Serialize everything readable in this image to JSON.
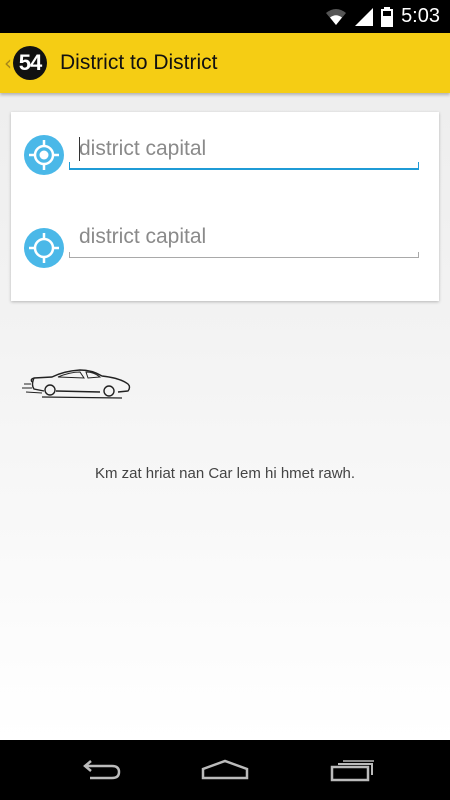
{
  "status_bar": {
    "time": "5:03",
    "icons": [
      "wifi-icon",
      "signal-icon",
      "battery-icon"
    ]
  },
  "action_bar": {
    "logo_text": "54",
    "title": "District to District",
    "background_color": "#f5cd14"
  },
  "form": {
    "origin": {
      "placeholder": "district capital",
      "value": "",
      "focused": true
    },
    "destination": {
      "placeholder": "district capital",
      "value": "",
      "focused": false
    },
    "accent_color": "#1f9bd6",
    "icon_color": "#4ab8e8"
  },
  "result": {
    "message": "Km zat hriat nan Car lem hi hmet rawh."
  },
  "nav_bar": {
    "icons": [
      "back-icon",
      "home-icon",
      "recent-apps-icon"
    ]
  }
}
